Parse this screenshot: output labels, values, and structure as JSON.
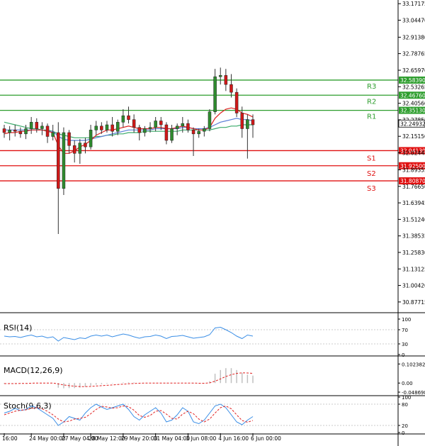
{
  "chart_data": {
    "type": "candlestick",
    "main": {
      "ylim": [
        30.8,
        33.2
      ],
      "price_ticks": [
        "33.17175",
        "33.04470",
        "32.91380",
        "32.78765",
        "32.65970",
        "32.53265",
        "32.40560",
        "32.27855",
        "32.15150",
        "32.02445",
        "31.89355",
        "31.76650",
        "31.63945",
        "31.51240",
        "31.38535",
        "31.25830",
        "31.13125",
        "31.00420",
        "30.87715"
      ],
      "candles": [
        [
          32.21,
          32.24,
          32.14,
          32.18
        ],
        [
          32.18,
          32.23,
          32.12,
          32.2
        ],
        [
          32.2,
          32.24,
          32.15,
          32.19
        ],
        [
          32.19,
          32.22,
          32.14,
          32.17
        ],
        [
          32.17,
          32.24,
          32.13,
          32.21
        ],
        [
          32.21,
          32.3,
          32.17,
          32.26
        ],
        [
          32.26,
          32.29,
          32.18,
          32.21
        ],
        [
          32.21,
          32.26,
          32.16,
          32.23
        ],
        [
          32.23,
          32.25,
          32.1,
          32.15
        ],
        [
          32.15,
          32.24,
          32.12,
          32.18
        ],
        [
          32.18,
          32.26,
          31.4,
          31.75
        ],
        [
          31.75,
          32.22,
          31.7,
          32.18
        ],
        [
          32.18,
          32.2,
          32.02,
          32.08
        ],
        [
          32.08,
          32.12,
          31.95,
          32.02
        ],
        [
          32.02,
          32.13,
          31.94,
          32.1
        ],
        [
          32.1,
          32.14,
          32.02,
          32.07
        ],
        [
          32.07,
          32.24,
          32.05,
          32.2
        ],
        [
          32.2,
          32.27,
          32.16,
          32.23
        ],
        [
          32.23,
          32.26,
          32.17,
          32.2
        ],
        [
          32.2,
          32.27,
          32.18,
          32.24
        ],
        [
          32.24,
          32.3,
          32.15,
          32.19
        ],
        [
          32.19,
          32.28,
          32.16,
          32.26
        ],
        [
          32.26,
          32.36,
          32.22,
          32.31
        ],
        [
          32.31,
          32.38,
          32.25,
          32.28
        ],
        [
          32.28,
          32.32,
          32.18,
          32.22
        ],
        [
          32.22,
          32.24,
          32.12,
          32.18
        ],
        [
          32.18,
          32.23,
          32.15,
          32.21
        ],
        [
          32.21,
          32.26,
          32.18,
          32.22
        ],
        [
          32.22,
          32.3,
          32.19,
          32.27
        ],
        [
          32.27,
          32.3,
          32.2,
          32.24
        ],
        [
          32.24,
          32.26,
          32.09,
          32.12
        ],
        [
          32.12,
          32.24,
          32.1,
          32.21
        ],
        [
          32.21,
          32.25,
          32.16,
          32.23
        ],
        [
          32.23,
          32.3,
          32.18,
          32.25
        ],
        [
          32.25,
          32.28,
          32.18,
          32.2
        ],
        [
          32.2,
          32.22,
          32.0,
          32.17
        ],
        [
          32.17,
          32.21,
          32.14,
          32.19
        ],
        [
          32.19,
          32.23,
          32.15,
          32.21
        ],
        [
          32.21,
          32.36,
          32.19,
          32.34
        ],
        [
          32.34,
          32.67,
          32.32,
          32.61
        ],
        [
          32.61,
          32.68,
          32.55,
          32.62
        ],
        [
          32.62,
          32.67,
          32.5,
          32.55
        ],
        [
          32.55,
          32.63,
          32.45,
          32.49
        ],
        [
          32.49,
          32.52,
          32.3,
          32.33
        ],
        [
          32.33,
          32.38,
          32.14,
          32.21
        ],
        [
          32.21,
          32.32,
          31.98,
          32.28
        ],
        [
          32.28,
          32.32,
          32.14,
          32.24
        ]
      ],
      "ma_red": [
        32.17,
        32.18,
        32.18,
        32.19,
        32.19,
        32.2,
        32.2,
        32.2,
        32.19,
        32.18,
        32.08,
        32.02,
        32.02,
        32.04,
        32.07,
        32.09,
        32.12,
        32.16,
        32.18,
        32.2,
        32.2,
        32.21,
        32.22,
        32.23,
        32.22,
        32.21,
        32.21,
        32.21,
        32.22,
        32.22,
        32.21,
        32.21,
        32.22,
        32.23,
        32.22,
        32.21,
        32.2,
        32.2,
        32.22,
        32.29,
        32.33,
        32.36,
        32.37,
        32.36,
        32.33,
        32.32,
        32.3
      ],
      "ma_blue": [
        32.2,
        32.2,
        32.2,
        32.2,
        32.2,
        32.2,
        32.2,
        32.2,
        32.19,
        32.19,
        32.15,
        32.13,
        32.12,
        32.12,
        32.12,
        32.12,
        32.13,
        32.14,
        32.15,
        32.16,
        32.17,
        32.18,
        32.19,
        32.2,
        32.2,
        32.2,
        32.2,
        32.2,
        32.21,
        32.21,
        32.21,
        32.21,
        32.21,
        32.22,
        32.22,
        32.21,
        32.21,
        32.21,
        32.22,
        32.24,
        32.26,
        32.27,
        32.28,
        32.29,
        32.28,
        32.28,
        32.27
      ],
      "ma_green": [
        32.26,
        32.25,
        32.24,
        32.23,
        32.22,
        32.21,
        32.21,
        32.2,
        32.2,
        32.19,
        32.17,
        32.16,
        32.15,
        32.14,
        32.14,
        32.14,
        32.14,
        32.15,
        32.15,
        32.16,
        32.16,
        32.17,
        32.17,
        32.18,
        32.18,
        32.18,
        32.19,
        32.19,
        32.19,
        32.19,
        32.19,
        32.19,
        32.19,
        32.2,
        32.2,
        32.2,
        32.2,
        32.2,
        32.2,
        32.21,
        32.22,
        32.22,
        32.23,
        32.23,
        32.24,
        32.24,
        32.24
      ],
      "levels": [
        {
          "name": "R3",
          "value": 32.5839,
          "label": "32.58390",
          "color": "#2e9e2e"
        },
        {
          "name": "R2",
          "value": 32.4676,
          "label": "32.46760",
          "color": "#2e9e2e"
        },
        {
          "name": "R1",
          "value": 32.3513,
          "label": "32.35130",
          "color": "#2e9e2e"
        },
        {
          "name": "S1",
          "value": 32.0413,
          "label": "32.04130",
          "color": "#e01010"
        },
        {
          "name": "S2",
          "value": 31.925,
          "label": "31.92500",
          "color": "#e01010"
        },
        {
          "name": "S3",
          "value": 31.8087,
          "label": "31.80870",
          "color": "#e01010"
        }
      ],
      "current_price": {
        "label": "32.24932",
        "value": 32.24932
      }
    },
    "x_ticks": [
      {
        "label": "16:00",
        "index": 0
      },
      {
        "label": "24 May 00:00",
        "index": 5
      },
      {
        "label": "27 May 04:00",
        "index": 11
      },
      {
        "label": "28 May 12:00",
        "index": 16
      },
      {
        "label": "29 May 20:00",
        "index": 22
      },
      {
        "label": "31 May 04:00",
        "index": 28
      },
      {
        "label": "3 Jun 08:00",
        "index": 34
      },
      {
        "label": "4 Jun 16:00",
        "index": 40
      },
      {
        "label": "6 Jun 00:00",
        "index": 46
      }
    ],
    "rsi": {
      "label": "RSI(14)",
      "ylim": [
        0,
        100
      ],
      "ticks": [
        "100",
        "70",
        "30",
        "0"
      ],
      "tick_values": [
        100,
        70,
        30,
        0
      ],
      "values": [
        52,
        50,
        51,
        48,
        52,
        55,
        50,
        52,
        47,
        50,
        38,
        48,
        45,
        42,
        47,
        45,
        52,
        55,
        52,
        55,
        50,
        54,
        58,
        55,
        50,
        46,
        50,
        51,
        55,
        52,
        45,
        51,
        52,
        54,
        50,
        46,
        48,
        50,
        56,
        75,
        77,
        70,
        62,
        52,
        45,
        55,
        52
      ]
    },
    "macd": {
      "label": "MACD(12,26,9)",
      "ylim": [
        -0.06,
        0.115
      ],
      "ticks": [
        "0.102382",
        "0.00",
        "-0.048698"
      ],
      "tick_values": [
        0.102382,
        0.0,
        -0.048698
      ],
      "histogram": [
        -0.004,
        -0.003,
        -0.002,
        -0.002,
        -0.001,
        0.001,
        0.001,
        0.001,
        0.0,
        0.0,
        -0.025,
        -0.028,
        -0.027,
        -0.027,
        -0.024,
        -0.02,
        -0.014,
        -0.009,
        -0.006,
        -0.003,
        -0.002,
        0.0,
        0.003,
        0.004,
        0.003,
        0.001,
        0.0,
        0.0,
        0.001,
        0.001,
        -0.001,
        -0.001,
        0.0,
        0.002,
        0.001,
        -0.002,
        -0.002,
        -0.001,
        0.01,
        0.05,
        0.07,
        0.08,
        0.08,
        0.07,
        0.055,
        0.045,
        0.04
      ],
      "signal": [
        -0.003,
        -0.003,
        -0.003,
        -0.002,
        -0.002,
        -0.001,
        0.0,
        0.0,
        0.0,
        0.0,
        -0.005,
        -0.01,
        -0.014,
        -0.017,
        -0.019,
        -0.019,
        -0.018,
        -0.016,
        -0.014,
        -0.012,
        -0.01,
        -0.008,
        -0.006,
        -0.004,
        -0.002,
        -0.001,
        0.0,
        0.0,
        0.0,
        0.0,
        0.0,
        0.0,
        0.0,
        0.0,
        0.0,
        0.0,
        -0.001,
        -0.001,
        0.001,
        0.01,
        0.022,
        0.035,
        0.045,
        0.052,
        0.055,
        0.054,
        0.052
      ]
    },
    "stoch": {
      "label": "Stoch(9,6,3)",
      "ylim": [
        0,
        100
      ],
      "ticks": [
        "100",
        "80",
        "20",
        "0"
      ],
      "tick_values": [
        100,
        80,
        20,
        0
      ],
      "main": [
        55,
        60,
        68,
        62,
        65,
        75,
        70,
        60,
        50,
        40,
        20,
        30,
        45,
        40,
        35,
        55,
        70,
        80,
        72,
        65,
        70,
        75,
        80,
        65,
        45,
        35,
        50,
        60,
        70,
        55,
        30,
        35,
        50,
        70,
        60,
        30,
        25,
        35,
        55,
        75,
        80,
        70,
        50,
        30,
        22,
        35,
        45
      ],
      "signal": [
        50,
        55,
        60,
        63,
        64,
        68,
        70,
        67,
        60,
        50,
        38,
        30,
        32,
        38,
        40,
        43,
        53,
        65,
        74,
        72,
        69,
        70,
        75,
        73,
        63,
        48,
        43,
        48,
        60,
        62,
        52,
        40,
        38,
        52,
        60,
        53,
        38,
        30,
        38,
        55,
        70,
        75,
        67,
        50,
        34,
        29,
        34
      ]
    }
  }
}
